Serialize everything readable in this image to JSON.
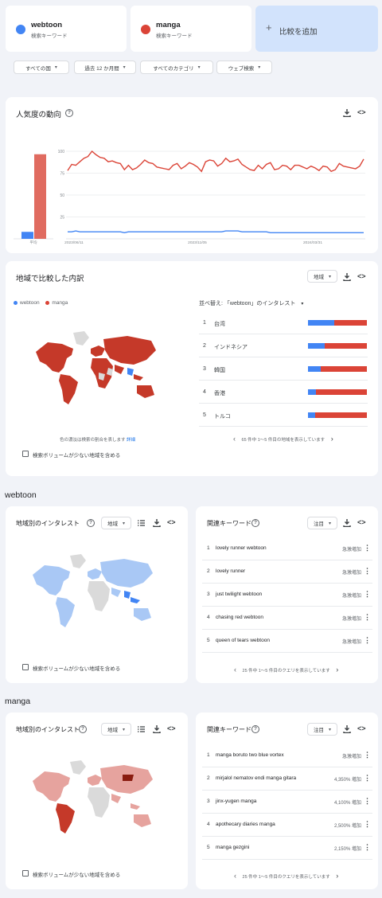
{
  "terms": [
    {
      "name": "webtoon",
      "sub": "検索キーワード",
      "color": "#4285f4"
    },
    {
      "name": "manga",
      "sub": "検索キーワード",
      "color": "#db4437"
    }
  ],
  "add_compare": {
    "plus": "+",
    "label": "比較を追加"
  },
  "filters": [
    "すべての国",
    "過去 12 か月間",
    "すべてのカテゴリ",
    "ウェブ検索"
  ],
  "interest_over_time": {
    "title": "人気度の動向",
    "avg_label": "平均",
    "embed": "<>"
  },
  "chart_data": {
    "type": "line",
    "title": "",
    "xlabel": "",
    "ylabel": "",
    "ylim": [
      0,
      100
    ],
    "ytick_labels": [
      "100",
      "75",
      "50",
      "25"
    ],
    "x_ticks": [
      "2023/06/11",
      "2023/11/05",
      "2024/03/31"
    ],
    "averages": [
      {
        "name": "webtoon",
        "value": 7
      },
      {
        "name": "manga",
        "value": 85
      }
    ],
    "series": [
      {
        "name": "webtoon",
        "color": "#4285f4",
        "values": [
          8,
          8,
          9,
          8,
          8,
          8,
          8,
          8,
          8,
          8,
          8,
          8,
          8,
          8,
          7,
          8,
          8,
          8,
          8,
          8,
          8,
          8,
          8,
          8,
          8,
          8,
          8,
          8,
          8,
          8,
          8,
          8,
          8,
          8,
          8,
          8,
          8,
          8,
          8,
          9,
          9,
          9,
          9,
          8,
          8,
          8,
          8,
          8,
          8,
          8,
          7,
          7,
          7,
          7,
          7,
          7,
          7,
          7,
          7,
          7,
          7,
          7,
          7,
          7,
          7,
          7,
          7,
          7,
          7,
          7,
          7,
          7,
          7,
          7
        ]
      },
      {
        "name": "manga",
        "color": "#db4437",
        "values": [
          78,
          85,
          84,
          88,
          92,
          94,
          100,
          96,
          93,
          92,
          88,
          89,
          87,
          86,
          79,
          84,
          79,
          81,
          85,
          90,
          87,
          86,
          82,
          81,
          80,
          79,
          84,
          86,
          80,
          83,
          87,
          85,
          82,
          77,
          88,
          90,
          89,
          83,
          86,
          92,
          88,
          89,
          91,
          85,
          82,
          79,
          78,
          84,
          80,
          85,
          87,
          79,
          80,
          84,
          83,
          79,
          84,
          84,
          82,
          80,
          83,
          81,
          78,
          83,
          82,
          77,
          79,
          86,
          83,
          82,
          81,
          80,
          83,
          91
        ]
      }
    ]
  },
  "region": {
    "title": "地域で比較した内訳",
    "dropdown": "地域",
    "embed": "<>",
    "legend": [
      "webtoon",
      "manga"
    ],
    "sort_label": "並べ替え: 「webtoon」のインタレスト",
    "rows": [
      {
        "rank": "1",
        "name": "台湾",
        "blue": 45
      },
      {
        "rank": "2",
        "name": "インドネシア",
        "blue": 29
      },
      {
        "rank": "3",
        "name": "韓国",
        "blue": 22
      },
      {
        "rank": "4",
        "name": "香港",
        "blue": 13
      },
      {
        "rank": "5",
        "name": "トルコ",
        "blue": 12
      }
    ],
    "map_note": "色の濃淡は検索の割合を表します",
    "map_note_link": "詳細",
    "pager": "65 件中 1～5 件目の地域を表示しています",
    "checkbox_label": "検索ボリュームが少ない地域を含める"
  },
  "webtoon_section": {
    "heading": "webtoon",
    "region_title": "地域別のインタレスト",
    "region_dropdown": "地域",
    "checkbox_label": "検索ボリュームが少ない地域を含める",
    "related_title": "関連キーワード",
    "related_dropdown": "注目",
    "embed": "<>",
    "keywords": [
      {
        "rank": "1",
        "name": "lovely runner webtoon",
        "val": "急激増加"
      },
      {
        "rank": "2",
        "name": "lovely runner",
        "val": "急激増加"
      },
      {
        "rank": "3",
        "name": "just twilight webtoon",
        "val": "急激増加"
      },
      {
        "rank": "4",
        "name": "chasing red webtoon",
        "val": "急激増加"
      },
      {
        "rank": "5",
        "name": "queen of tears webtoon",
        "val": "急激増加"
      }
    ],
    "pager": "25 件中 1～5 件目のクエリを表示しています"
  },
  "manga_section": {
    "heading": "manga",
    "region_title": "地域別のインタレスト",
    "region_dropdown": "地域",
    "checkbox_label": "検索ボリュームが少ない地域を含める",
    "related_title": "関連キーワード",
    "related_dropdown": "注目",
    "embed": "<>",
    "keywords": [
      {
        "rank": "1",
        "name": "manga boruto two blue vortex",
        "val": "急激増加"
      },
      {
        "rank": "2",
        "name": "mirjalol nematov endi manga gitara",
        "val": "4,350% 増加"
      },
      {
        "rank": "3",
        "name": "jinx-yugen manga",
        "val": "4,100% 増加"
      },
      {
        "rank": "4",
        "name": "apothecary diaries manga",
        "val": "2,500% 増加"
      },
      {
        "rank": "5",
        "name": "manga gezgini",
        "val": "2,150% 増加"
      }
    ],
    "pager": "25 件中 1～5 件目のクエリを表示しています"
  },
  "colors": {
    "blue": "#4285f4",
    "red": "#db4437",
    "light_red": "#e6a39e",
    "light_blue": "#a9c8f5",
    "gray": "#dadada"
  },
  "icons": {
    "help": "?",
    "download": "download-icon",
    "embed": "embed-icon",
    "list": "list-icon",
    "more": "⋮",
    "chev_left": "‹",
    "chev_right": "›",
    "caret": "▾"
  }
}
